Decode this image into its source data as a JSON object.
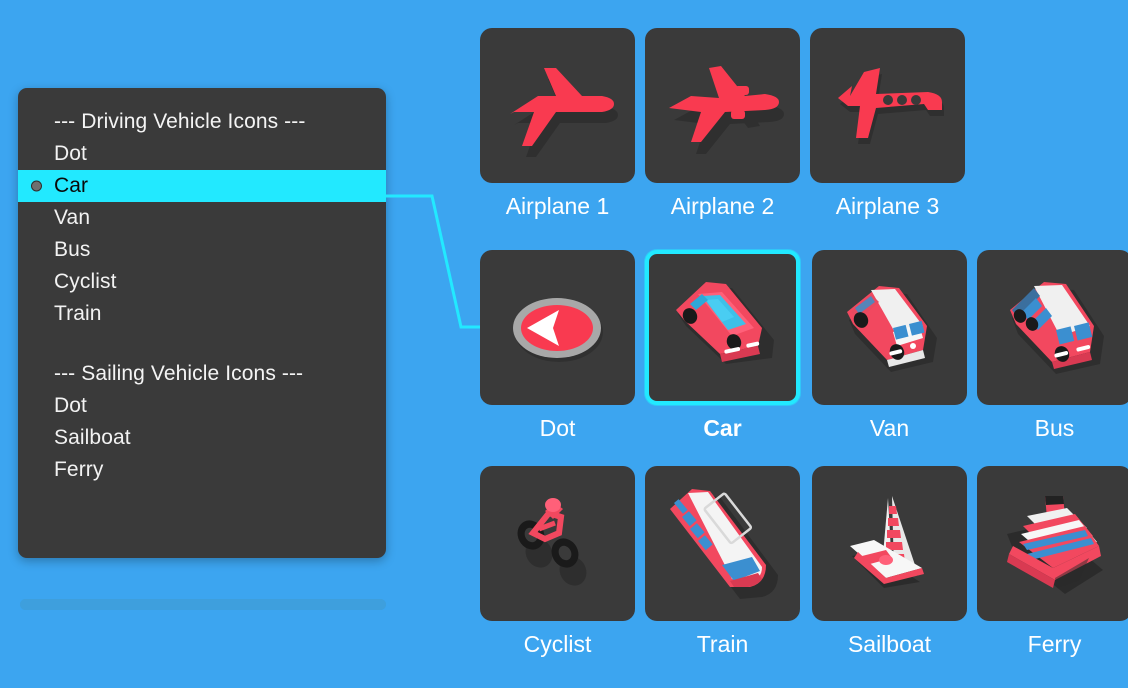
{
  "theme": {
    "background": "#3ca5f0",
    "panel_bg": "#3a3a3a",
    "accent_cyan": "#22e9ff",
    "icon_red": "#f93a50",
    "label_white": "#ffffff",
    "scrollbar": "#3e9fdd"
  },
  "menu": {
    "groups": [
      {
        "header": "--- Driving Vehicle Icons ---",
        "items": [
          "Dot",
          "Car",
          "Van",
          "Bus",
          "Cyclist",
          "Train"
        ]
      },
      {
        "header": "--- Sailing Vehicle Icons ---",
        "items": [
          "Dot",
          "Sailboat",
          "Ferry"
        ]
      }
    ],
    "selected": "Car"
  },
  "grid": {
    "rows": [
      {
        "name": "airplanes",
        "tiles": [
          {
            "label": "Airplane 1",
            "icon": "airplane-1-icon",
            "selected": false
          },
          {
            "label": "Airplane 2",
            "icon": "airplane-2-icon",
            "selected": false
          },
          {
            "label": "Airplane 3",
            "icon": "airplane-3-icon",
            "selected": false
          }
        ]
      },
      {
        "name": "driving",
        "tiles": [
          {
            "label": "Dot",
            "icon": "dot-arrow-icon",
            "selected": false
          },
          {
            "label": "Car",
            "icon": "car-icon",
            "selected": true
          },
          {
            "label": "Van",
            "icon": "van-icon",
            "selected": false
          },
          {
            "label": "Bus",
            "icon": "bus-icon",
            "selected": false
          }
        ]
      },
      {
        "name": "rail-sailing",
        "tiles": [
          {
            "label": "Cyclist",
            "icon": "cyclist-icon",
            "selected": false
          },
          {
            "label": "Train",
            "icon": "train-icon",
            "selected": false
          },
          {
            "label": "Sailboat",
            "icon": "sailboat-icon",
            "selected": false
          },
          {
            "label": "Ferry",
            "icon": "ferry-icon",
            "selected": false
          }
        ]
      }
    ]
  }
}
